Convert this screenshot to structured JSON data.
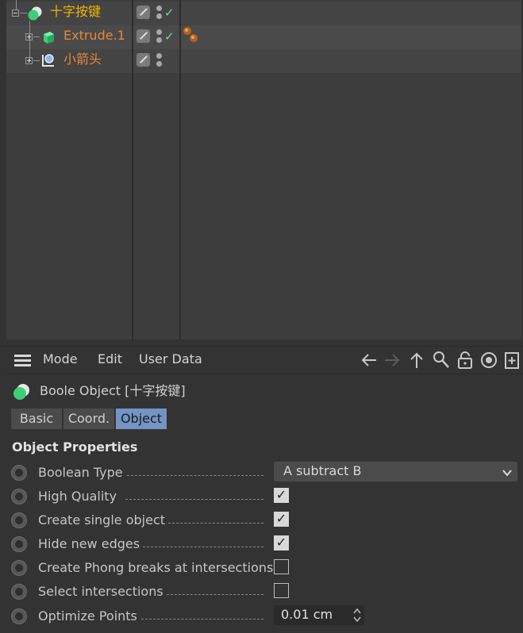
{
  "object_manager": {
    "objects": [
      {
        "name": "十字按键",
        "type": "boole",
        "name_color": "#f0b400",
        "expanded": true,
        "enabled": true,
        "tag": ""
      },
      {
        "name": "Extrude.1",
        "type": "extrude",
        "name_color": "#e6873a",
        "expanded": false,
        "enabled": true,
        "tag": "material-tag"
      },
      {
        "name": "小箭头",
        "type": "spline",
        "name_color": "#e6873a",
        "expanded": false,
        "enabled": false,
        "tag": ""
      }
    ]
  },
  "attribute_manager": {
    "menu": {
      "mode": "Mode",
      "edit": "Edit",
      "user_data": "User Data"
    },
    "nav_icons": [
      "arrow-left-icon",
      "arrow-right-icon",
      "arrow-up-icon",
      "search-icon",
      "lock-icon",
      "target-icon",
      "new-panel-icon"
    ],
    "object_title": "Boole Object [十字按键]",
    "tabs": [
      {
        "label": "Basic",
        "active": false
      },
      {
        "label": "Coord.",
        "active": false
      },
      {
        "label": "Object",
        "active": true
      }
    ],
    "section_title": "Object Properties",
    "properties": {
      "boolean_type": {
        "label": "Boolean Type",
        "value": "A subtract B"
      },
      "high_quality": {
        "label": "High Quality",
        "checked": true
      },
      "create_single_object": {
        "label": "Create single object",
        "checked": true
      },
      "hide_new_edges": {
        "label": "Hide new edges",
        "checked": true
      },
      "create_phong_breaks": {
        "label": "Create Phong breaks at intersections",
        "checked": false
      },
      "select_intersections": {
        "label": "Select intersections",
        "checked": false
      },
      "optimize_points": {
        "label": "Optimize Points",
        "value": "0.01 cm"
      }
    }
  },
  "colors": {
    "panel_bg": "#3d3d3d",
    "accent_tab": "#7394c4",
    "enabled_check": "#6fdc8c",
    "boole_name": "#f0b400",
    "child_name": "#e6873a"
  }
}
